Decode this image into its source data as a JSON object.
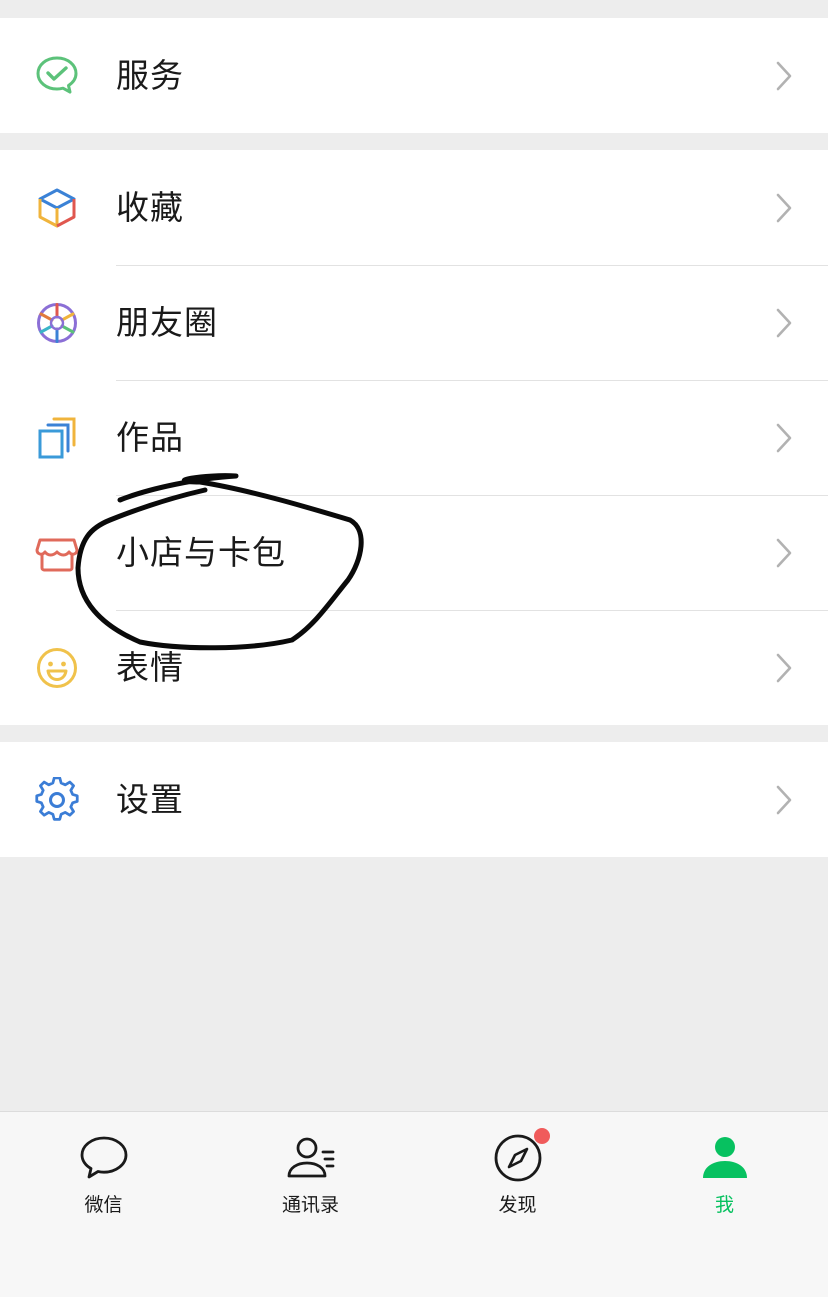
{
  "groups": [
    {
      "items": [
        {
          "label": "服务",
          "icon": "wechat-pay-icon",
          "color": "#5cc27a"
        }
      ]
    },
    {
      "items": [
        {
          "label": "收藏",
          "icon": "favorites-cube-icon",
          "color": "#3b82d6"
        },
        {
          "label": "朋友圈",
          "icon": "moments-aperture-icon",
          "color": "#e05a4f"
        },
        {
          "label": "作品",
          "icon": "works-layers-icon",
          "color": "#3a9ad9"
        },
        {
          "label": "小店与卡包",
          "icon": "shop-awning-icon",
          "color": "#e06a5b"
        },
        {
          "label": "表情",
          "icon": "smiley-face-icon",
          "color": "#f0c24b"
        }
      ]
    },
    {
      "items": [
        {
          "label": "设置",
          "icon": "gear-icon",
          "color": "#3b7dd6"
        }
      ]
    }
  ],
  "tabbar": {
    "tabs": [
      {
        "label": "微信",
        "icon": "chat-bubble-icon",
        "active": false
      },
      {
        "label": "通讯录",
        "icon": "contacts-icon",
        "active": false
      },
      {
        "label": "发现",
        "icon": "compass-icon",
        "active": false,
        "badge": true
      },
      {
        "label": "我",
        "icon": "person-icon",
        "active": true
      }
    ],
    "active_color": "#07c160",
    "badge_color": "#f05b5b"
  },
  "annotation": {
    "type": "hand-drawn-circle",
    "target": "小店与卡包",
    "color": "#000000"
  }
}
